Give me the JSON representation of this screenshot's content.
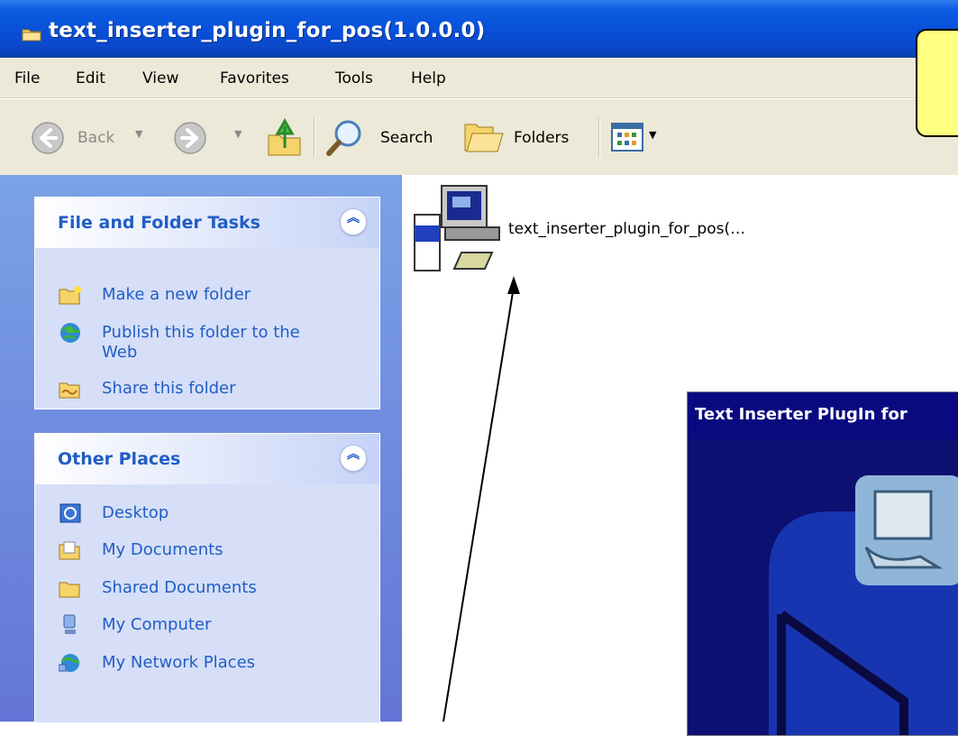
{
  "window": {
    "title": "text_inserter_plugin_for_pos(1.0.0.0)"
  },
  "menu": {
    "items": [
      {
        "label": "File"
      },
      {
        "label": "Edit"
      },
      {
        "label": "View"
      },
      {
        "label": "Favorites"
      },
      {
        "label": "Tools"
      },
      {
        "label": "Help"
      }
    ]
  },
  "toolbar": {
    "back_label": "Back",
    "search_label": "Search",
    "folders_label": "Folders"
  },
  "tasks": {
    "file_folder": {
      "title": "File and Folder Tasks",
      "items": [
        {
          "label": "Make a new folder",
          "icon": "new-folder-icon"
        },
        {
          "label": "Publish this folder to the",
          "label2": "Web",
          "icon": "publish-globe-icon"
        },
        {
          "label": "Share this folder",
          "icon": "share-folder-icon"
        }
      ]
    },
    "other_places": {
      "title": "Other Places",
      "items": [
        {
          "label": "Desktop",
          "icon": "desktop-icon"
        },
        {
          "label": "My Documents",
          "icon": "my-documents-icon"
        },
        {
          "label": "Shared Documents",
          "icon": "shared-documents-icon"
        },
        {
          "label": "My Computer",
          "icon": "my-computer-icon"
        },
        {
          "label": "My Network Places",
          "icon": "network-places-icon"
        }
      ]
    }
  },
  "file": {
    "name": "text_inserter_plugin_for_pos(…",
    "icon": "installer-icon"
  },
  "splash": {
    "title": "Text Inserter PlugIn for"
  },
  "colors": {
    "titlebar": "#0a50d8",
    "task_link": "#215dc6",
    "note": "#ffff80"
  }
}
